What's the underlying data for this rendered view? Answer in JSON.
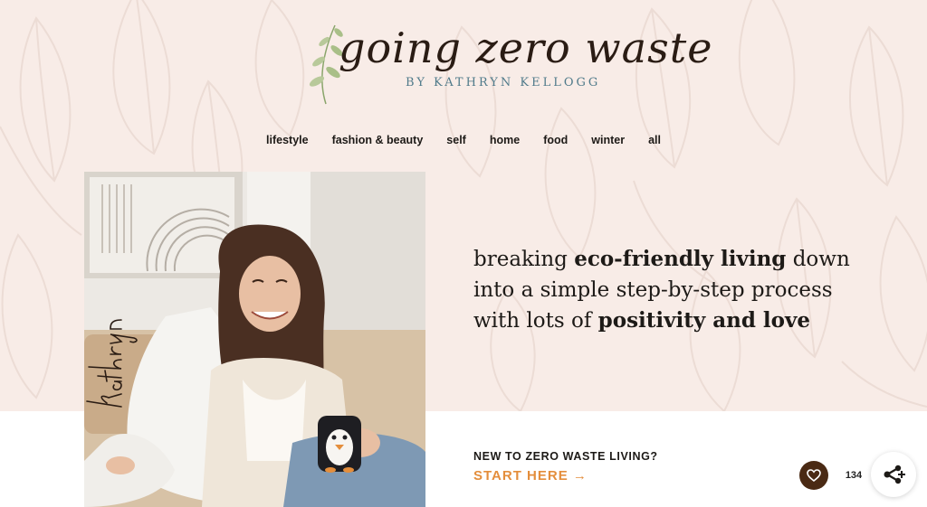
{
  "brand": {
    "logo_script": "going zero waste",
    "logo_byline": "BY KATHRYN KELLOGG"
  },
  "nav": {
    "items": [
      "lifestyle",
      "fashion & beauty",
      "self",
      "home",
      "food",
      "winter",
      "all"
    ]
  },
  "hero": {
    "signature": "kathryn",
    "tagline_parts": [
      {
        "text": "breaking ",
        "bold": false
      },
      {
        "text": "eco-friendly living",
        "bold": true
      },
      {
        "text": " down into a simple step-by-step process with lots of ",
        "bold": false
      },
      {
        "text": "positivity and love",
        "bold": true
      }
    ]
  },
  "cta": {
    "question": "NEW TO ZERO WASTE LIVING?",
    "link_label": "START HERE →"
  },
  "floating": {
    "favorite_count": "134",
    "favorite_icon": "heart-icon",
    "share_icon": "share-icon"
  },
  "colors": {
    "hero_bg": "#f8ece7",
    "accent_orange": "#e48e3c",
    "text_dark": "#1d1a17",
    "heart_button": "#4a2a14",
    "byline_teal": "#4f7a8a"
  }
}
